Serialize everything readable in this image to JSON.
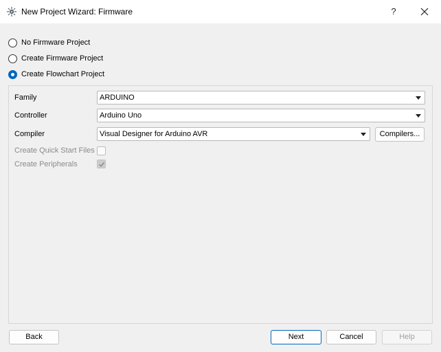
{
  "window": {
    "title": "New Project Wizard: Firmware",
    "help_label": "?",
    "icons": {
      "app": "app-icon",
      "close": "close-icon"
    }
  },
  "project_type": {
    "options": [
      {
        "label": "No Firmware Project",
        "checked": false
      },
      {
        "label": "Create Firmware Project",
        "checked": false
      },
      {
        "label": "Create Flowchart Project",
        "checked": true
      }
    ]
  },
  "form": {
    "family": {
      "label": "Family",
      "value": "ARDUINO"
    },
    "controller": {
      "label": "Controller",
      "value": "Arduino Uno"
    },
    "compiler": {
      "label": "Compiler",
      "value": "Visual Designer for Arduino AVR",
      "button_label": "Compilers..."
    },
    "quick_start": {
      "label": "Create Quick Start Files",
      "checked": false,
      "enabled": false
    },
    "peripherals": {
      "label": "Create Peripherals",
      "checked": true,
      "enabled": false
    }
  },
  "footer": {
    "back_label": "Back",
    "next_label": "Next",
    "cancel_label": "Cancel",
    "help_label": "Help"
  },
  "colors": {
    "accent": "#0067c0",
    "background": "#f0f0f0",
    "disabled_text": "#8a8a8a"
  }
}
